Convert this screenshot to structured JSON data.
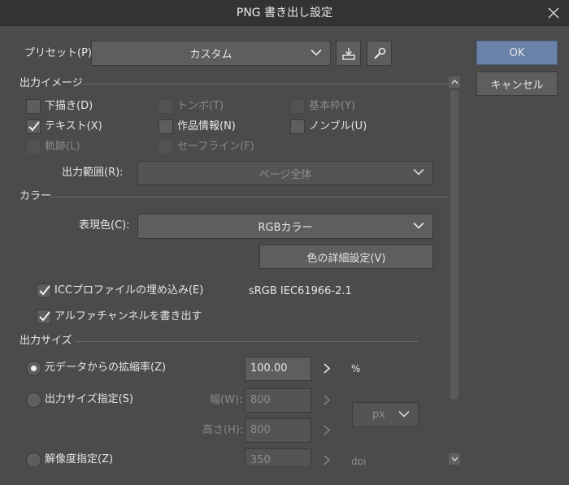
{
  "window": {
    "title": "PNG 書き出し設定"
  },
  "preset": {
    "label": "プリセット(P):",
    "value": "カスタム"
  },
  "buttons": {
    "ok": "OK",
    "cancel": "キャンセル",
    "color_detail": "色の詳細設定(V)"
  },
  "output_image": {
    "heading": "出力イメージ",
    "checkboxes": [
      {
        "label": "下描き(D)",
        "checked": false,
        "enabled": true
      },
      {
        "label": "トンボ(T)",
        "checked": false,
        "enabled": false
      },
      {
        "label": "基本枠(Y)",
        "checked": false,
        "enabled": false
      },
      {
        "label": "テキスト(X)",
        "checked": true,
        "enabled": true
      },
      {
        "label": "作品情報(N)",
        "checked": false,
        "enabled": true
      },
      {
        "label": "ノンブル(U)",
        "checked": false,
        "enabled": true
      },
      {
        "label": "軌跡(L)",
        "checked": false,
        "enabled": false
      },
      {
        "label": "セーフライン(F)",
        "checked": false,
        "enabled": false
      }
    ],
    "range_label": "出力範囲(R):",
    "range_value": "ページ全体"
  },
  "color": {
    "heading": "カラー",
    "expression_label": "表現色(C):",
    "expression_value": "RGBカラー",
    "icc_label": "ICCプロファイルの埋め込み(E)",
    "icc_checked": true,
    "icc_profile": "sRGB IEC61966-2.1",
    "alpha_label": "アルファチャンネルを書き出す",
    "alpha_checked": true
  },
  "output_size": {
    "heading": "出力サイズ",
    "scale_label": "元データからの拡縮率(Z)",
    "scale_value": "100.00",
    "scale_unit": "%",
    "size_label": "出力サイズ指定(S)",
    "width_label": "幅(W):",
    "width_value": "800",
    "height_label": "高さ(H):",
    "height_value": "800",
    "size_unit": "px",
    "res_label": "解像度指定(Z)",
    "res_value": "350",
    "res_unit": "dpi"
  }
}
